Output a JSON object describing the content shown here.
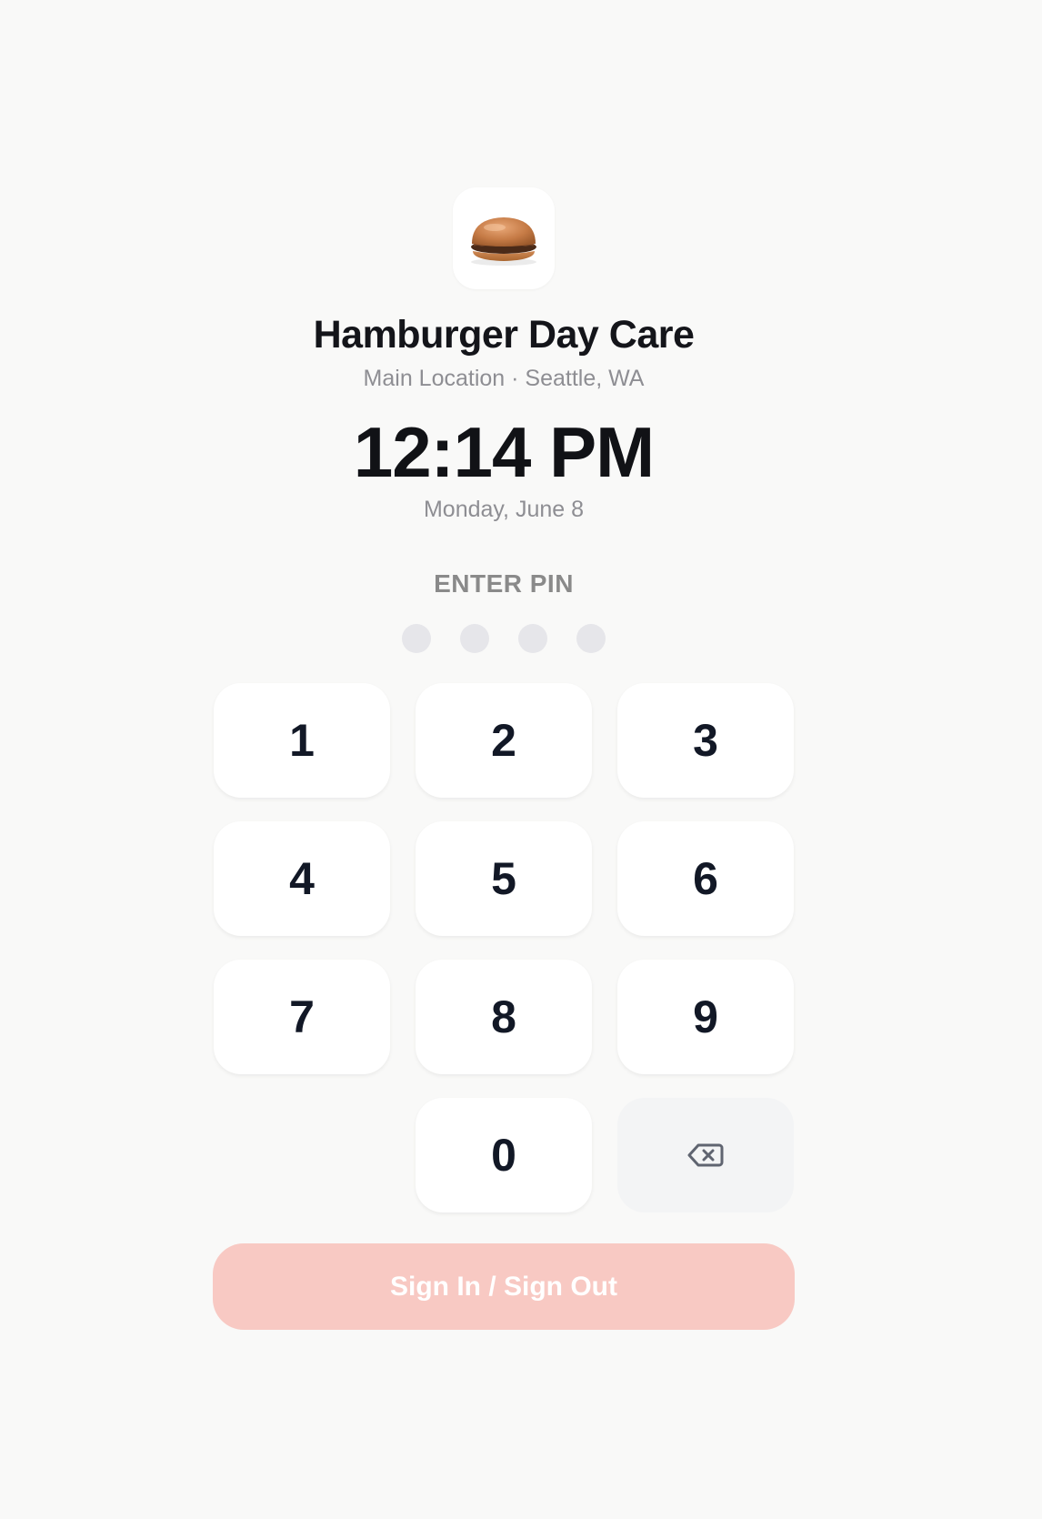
{
  "brand": {
    "logo_icon": "hamburger-icon",
    "name": "Hamburger Day Care",
    "location": "Main Location · Seattle, WA"
  },
  "clock": {
    "time": "12:14 PM",
    "date": "Monday, June 8"
  },
  "pin": {
    "label": "ENTER PIN",
    "length": 4,
    "entered": 0
  },
  "keypad": {
    "keys": [
      "1",
      "2",
      "3",
      "4",
      "5",
      "6",
      "7",
      "8",
      "9",
      "0"
    ],
    "backspace_icon": "backspace-icon"
  },
  "action": {
    "label": "Sign In / Sign Out",
    "color": "#f8c9c3",
    "enabled": false
  }
}
